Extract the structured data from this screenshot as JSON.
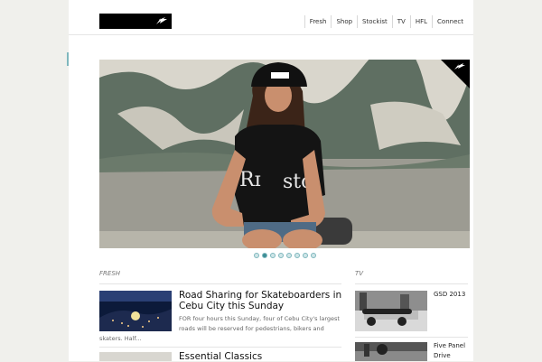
{
  "nav": {
    "items": [
      "Fresh",
      "Shop",
      "Stockist",
      "TV",
      "HFL",
      "Connect"
    ]
  },
  "hero": {
    "slide_count": 8,
    "active_slide": 2
  },
  "fresh": {
    "section_label": "FRESH",
    "posts": [
      {
        "title_line1": "Road Sharing for Skateboarders in",
        "title_line2": "Cebu City this Sunday",
        "excerpt_line1": "FOR four hours this Sunday, four of Cebu City's largest",
        "excerpt_line2": "roads will be reserved for pedestrians, bikers and",
        "excerpt_line3": "skaters. Half..."
      },
      {
        "title_line1": "Essential Classics"
      }
    ]
  },
  "tv": {
    "section_label": "TV",
    "items": [
      {
        "title_line1": "GSD 2013",
        "title_line2": ""
      },
      {
        "title_line1": "Five Panel",
        "title_line2": "Drive"
      }
    ]
  },
  "colors": {
    "accent": "#7fb7bd",
    "accent_dark": "#3e8e96",
    "logo_bg": "#000000"
  }
}
